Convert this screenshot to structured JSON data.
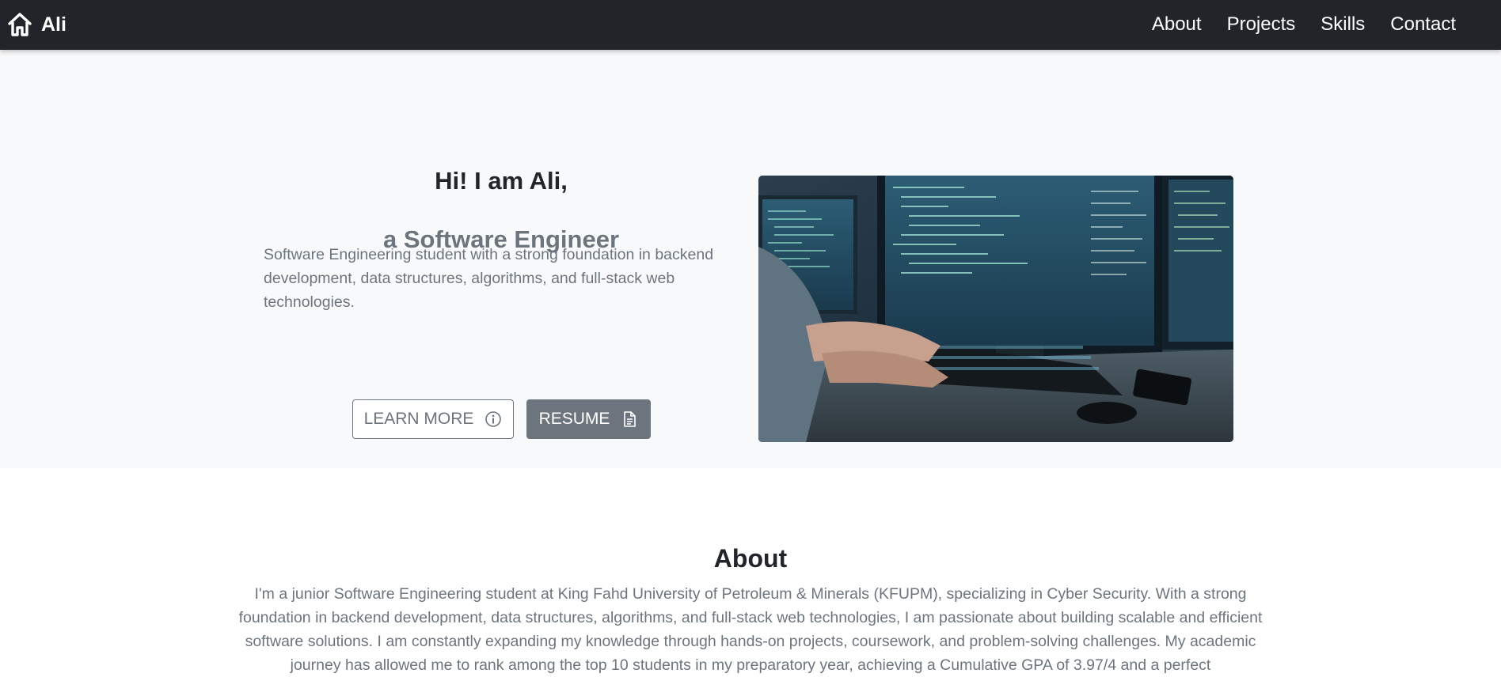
{
  "navbar": {
    "brand": "Ali",
    "brand_icon": "home-icon",
    "links": [
      "About",
      "Projects",
      "Skills",
      "Contact"
    ],
    "background": "#212529"
  },
  "hero": {
    "title": "Hi! I am Ali,",
    "subtitle": "a Software Engineer",
    "description": "Software Engineering student with a strong foundation in backend development, data structures, algorithms, and full-stack web technologies.",
    "learn_more_label": "LEARN MORE",
    "learn_more_icon": "info-circle-icon",
    "resume_label": "RESUME",
    "resume_icon": "document-icon",
    "image": "developer-typing-at-computer-photo",
    "background": "#f8f9fa"
  },
  "about": {
    "title": "About",
    "text": "I'm a junior Software Engineering student at King Fahd University of Petroleum & Minerals (KFUPM), specializing in Cyber Security. With a strong foundation in backend development, data structures, algorithms, and full-stack web technologies, I am passionate about building scalable and efficient software solutions. I am constantly expanding my knowledge through hands-on projects, coursework, and problem-solving challenges. My academic journey has allowed me to rank among the top 10 students in my preparatory year, achieving a Cumulative GPA of 3.97/4 and a perfect"
  },
  "colors": {
    "muted": "#6c757d",
    "dark": "#212529"
  }
}
